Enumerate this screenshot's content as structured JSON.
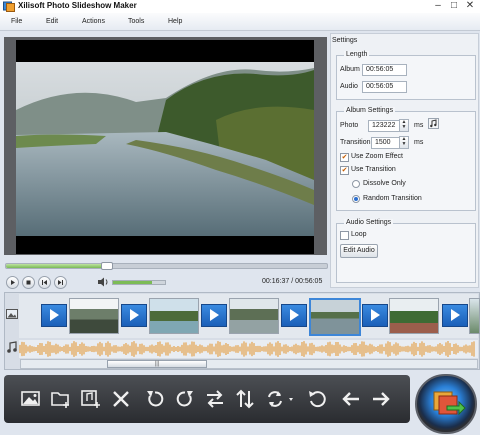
{
  "window": {
    "title": "Xilisoft Photo Slideshow Maker",
    "minimize": "–",
    "maximize": "□",
    "close": "✕"
  },
  "menu": [
    "File",
    "Edit",
    "Actions",
    "Tools",
    "Help"
  ],
  "player": {
    "time_current": "00:16:37",
    "time_total": "00:56:05",
    "separator": " / ",
    "progress": 0.31,
    "volume": 0.75
  },
  "settings": {
    "title": "Settings",
    "length": {
      "title": "Length",
      "album_label": "Album",
      "album_value": "00:56:05",
      "audio_label": "Audio",
      "audio_value": "00:56:05"
    },
    "album_settings": {
      "title": "Album Settings",
      "photo_label": "Photo",
      "photo_value": "123222",
      "photo_unit": "ms",
      "transition_label": "Transition",
      "transition_value": "1500",
      "transition_unit": "ms",
      "zoom_label": "Use Zoom Effect",
      "zoom_checked": true,
      "use_transition_label": "Use Transition",
      "use_transition_checked": true,
      "dissolve_label": "Dissolve Only",
      "random_label": "Random Transition",
      "selected_option": "random"
    },
    "audio_settings": {
      "title": "Audio Settings",
      "loop_label": "Loop",
      "loop_checked": false,
      "edit_audio_label": "Edit Audio"
    }
  },
  "timeline": {
    "scroll_grip": "|||"
  },
  "toolbar": [
    "add-photo-icon",
    "add-folder-icon",
    "add-music-icon",
    "delete-icon",
    "rotate-left-icon",
    "rotate-right-icon",
    "swap-horizontal-icon",
    "swap-vertical-icon",
    "transition-icon",
    "undo-icon",
    "move-left-icon",
    "move-right-icon"
  ],
  "colors": {
    "accent": "#2a7fd6",
    "transition": "#2d7bd6",
    "waveform": "#e4a14a"
  }
}
